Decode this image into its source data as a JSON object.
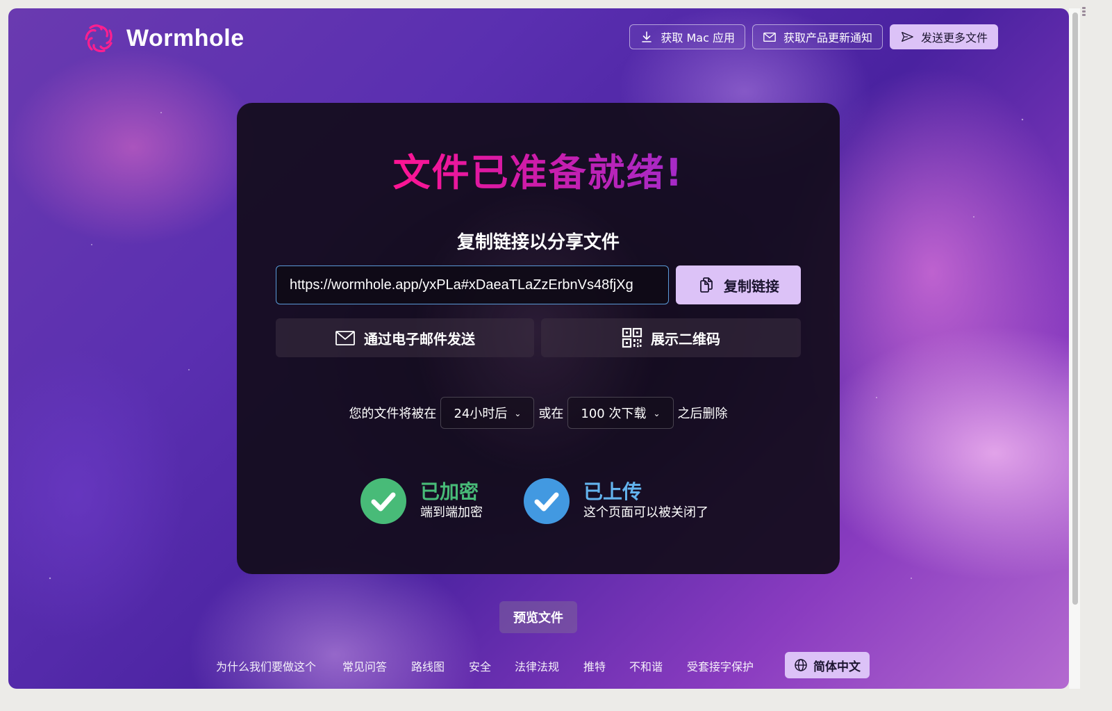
{
  "app": {
    "name": "Wormhole",
    "logo_icon": "wormhole-spiral-icon",
    "brand_color": "#ff1493",
    "accent_button_color": "#dcc2f7"
  },
  "header": {
    "buttons": [
      {
        "label": "获取 Mac 应用",
        "icon": "download-icon"
      },
      {
        "label": "获取产品更新通知",
        "icon": "mail-icon"
      },
      {
        "label": "发送更多文件",
        "icon": "send-icon"
      }
    ]
  },
  "card": {
    "headline": "文件已准备就绪!",
    "subtitle": "复制链接以分享文件",
    "share_url": "https://wormhole.app/yxPLa#xDaeaTLaZzErbnVs48fjXg",
    "copy_button": {
      "label": "复制链接",
      "icon": "copy-icon"
    },
    "email_button": {
      "label": "通过电子邮件发送",
      "icon": "mail-icon"
    },
    "qr_button": {
      "label": "展示二维码",
      "icon": "qr-code-icon"
    },
    "expiry": {
      "prefix": "您的文件将被在",
      "time_value": "24小时后",
      "middle": "或在",
      "downloads_value": "100 次下载",
      "suffix": "之后删除"
    },
    "status": [
      {
        "title": "已加密",
        "subtitle": "端到端加密",
        "color": "#48bb78",
        "icon": "check-circle-icon"
      },
      {
        "title": "已上传",
        "subtitle": "这个页面可以被关闭了",
        "color": "#4299e1",
        "icon": "check-circle-icon"
      }
    ]
  },
  "preview_button": "预览文件",
  "footer": {
    "links": [
      "为什么我们要做这个",
      "常见问答",
      "路线图",
      "安全",
      "法律法规",
      "推特",
      "不和谐",
      "受套接字保护"
    ],
    "language_button": {
      "label": "简体中文",
      "icon": "globe-icon"
    }
  }
}
